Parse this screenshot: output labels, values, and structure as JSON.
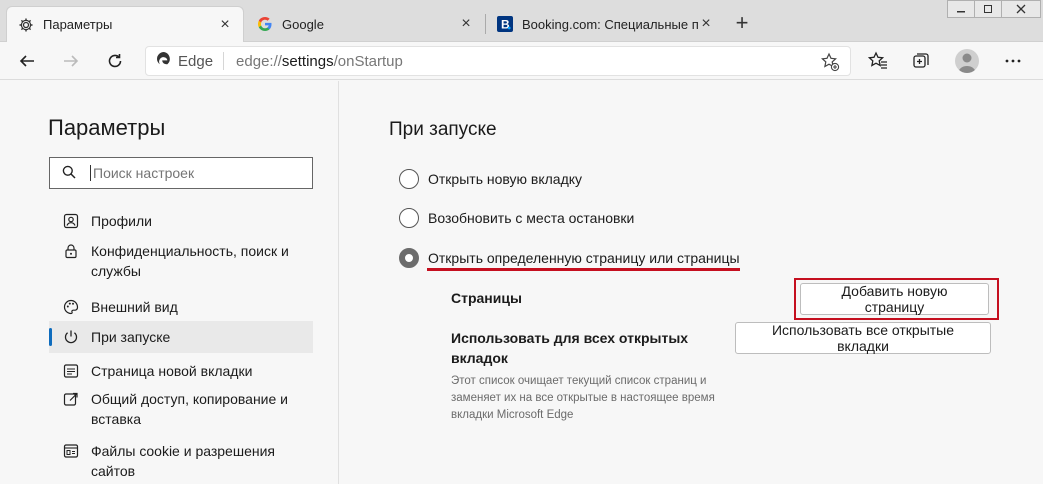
{
  "tabs": [
    {
      "title": "Параметры",
      "favicon": "gear-icon",
      "active": true
    },
    {
      "title": "Google",
      "favicon": "google-g-icon",
      "active": false
    },
    {
      "title": "Booking.com: Специальные пре",
      "favicon": "booking-b-icon",
      "active": false
    }
  ],
  "window_controls": {
    "minimize": "▭",
    "restore": "⧉",
    "close": "✕"
  },
  "address": {
    "chip_label": "Edge",
    "url_prefix": "edge://",
    "url_path": "settings",
    "url_suffix": "/onStartup"
  },
  "sidebar": {
    "title": "Параметры",
    "search_placeholder": "Поиск настроек",
    "items": [
      {
        "label": "Профили",
        "icon": "profile-icon",
        "selected": false
      },
      {
        "label": "Конфиденциальность, поиск и службы",
        "icon": "lock-icon",
        "selected": false
      },
      {
        "label": "Внешний вид",
        "icon": "palette-icon",
        "selected": false
      },
      {
        "label": "При запуске",
        "icon": "power-icon",
        "selected": true
      },
      {
        "label": "Страница новой вкладки",
        "icon": "newtab-page-icon",
        "selected": false
      },
      {
        "label": "Общий доступ, копирование и вставка",
        "icon": "share-icon",
        "selected": false
      },
      {
        "label": "Файлы cookie и разрешения сайтов",
        "icon": "cookie-icon",
        "selected": false
      }
    ]
  },
  "main": {
    "heading": "При запуске",
    "options": [
      {
        "label": "Открыть новую вкладку",
        "checked": false
      },
      {
        "label": "Возобновить с места остановки",
        "checked": false
      },
      {
        "label": "Открыть определенную страницу или страницы",
        "checked": true
      }
    ],
    "pages_label": "Страницы",
    "add_page_button": "Добавить новую страницу",
    "use_all_label": "Использовать для всех открытых вкладок",
    "use_all_desc": "Этот список очищает текущий список страниц и заменяет их на все открытые в настоящее время вкладки Microsoft Edge",
    "use_all_button": "Использовать все открытые вкладки"
  },
  "colors": {
    "accent_blue": "#0f6cbd",
    "highlight_red": "#c50f1f",
    "tab_strip": "#dddddd",
    "page_bg": "#f7f7f7"
  }
}
